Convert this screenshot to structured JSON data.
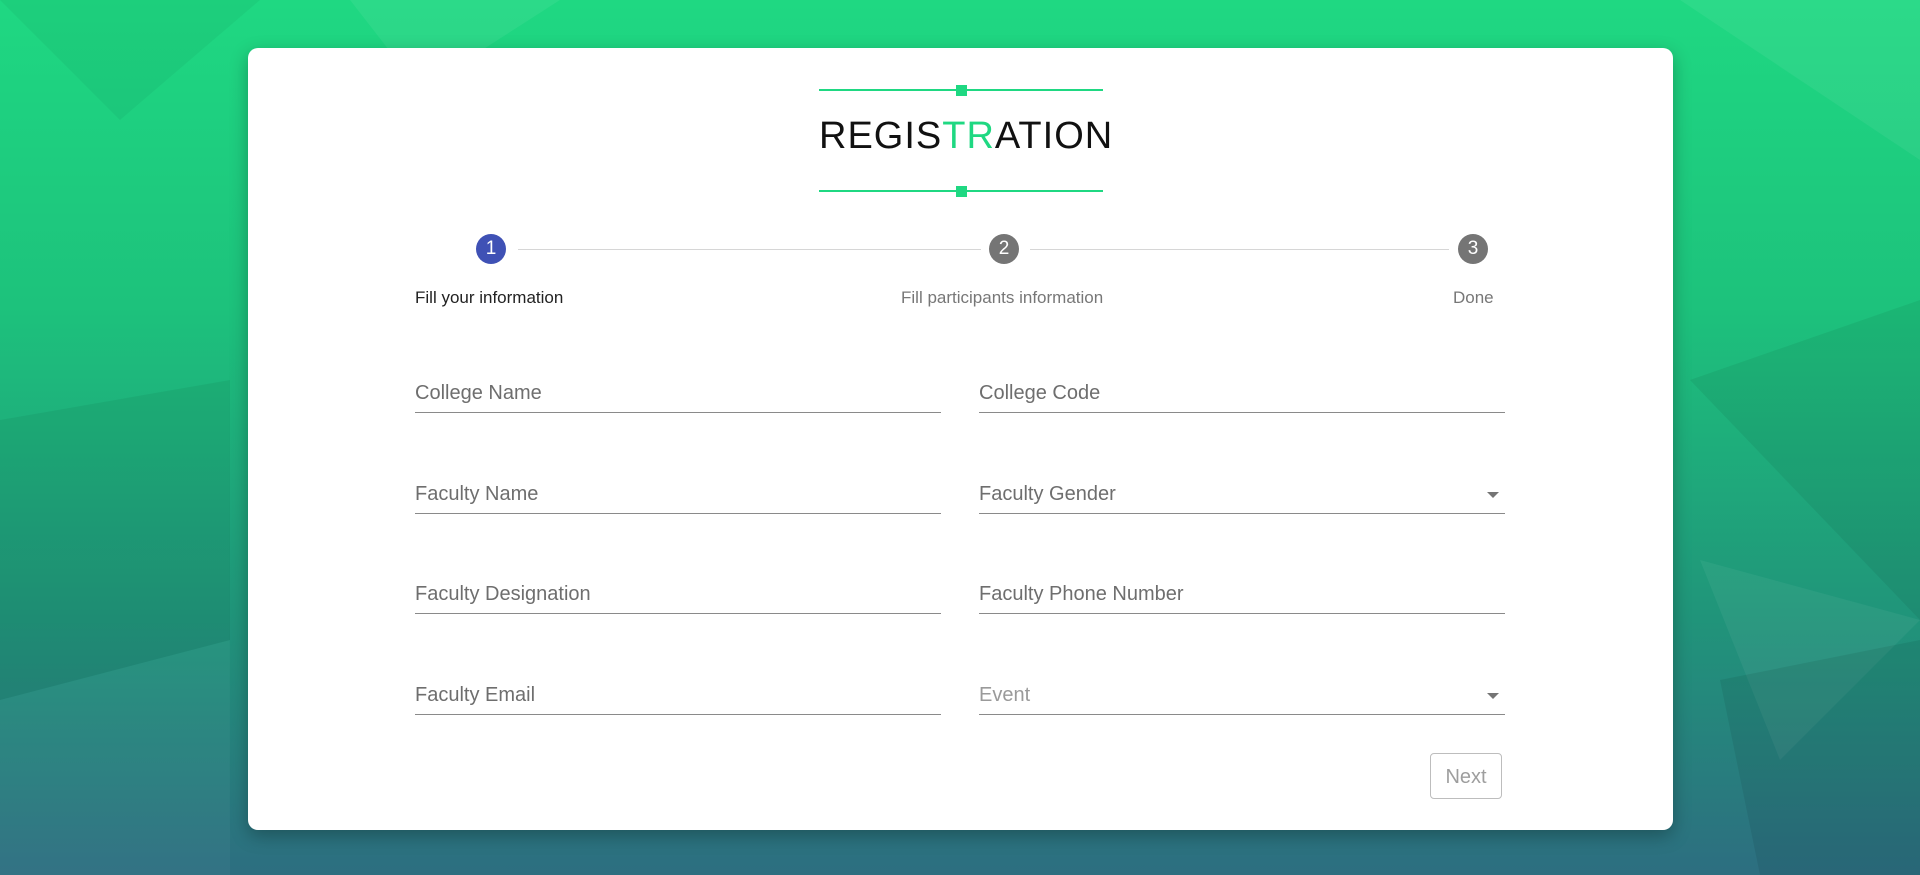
{
  "colors": {
    "accent": "#1fd882",
    "step_active": "#3f51b5",
    "step_inactive": "#757575"
  },
  "logo": {
    "part1": "REGIS",
    "accent": "TR",
    "part2": "ATION"
  },
  "stepper": {
    "steps": [
      {
        "number": "1",
        "label": "Fill your information",
        "state": "active"
      },
      {
        "number": "2",
        "label": "Fill participants information",
        "state": "inactive"
      },
      {
        "number": "3",
        "label": "Done",
        "state": "inactive"
      }
    ]
  },
  "form": {
    "college_name": {
      "placeholder": "College Name",
      "value": ""
    },
    "college_code": {
      "placeholder": "College Code",
      "value": ""
    },
    "faculty_name": {
      "placeholder": "Faculty Name",
      "value": ""
    },
    "faculty_gender": {
      "placeholder": "Faculty Gender",
      "value": "",
      "icon": "chevron-down-icon"
    },
    "faculty_designation": {
      "placeholder": "Faculty Designation",
      "value": ""
    },
    "faculty_phone": {
      "placeholder": "Faculty Phone Number",
      "value": ""
    },
    "faculty_email": {
      "placeholder": "Faculty Email",
      "value": ""
    },
    "event": {
      "placeholder": "Event",
      "value": "",
      "icon": "chevron-down-icon"
    }
  },
  "actions": {
    "next_label": "Next"
  }
}
